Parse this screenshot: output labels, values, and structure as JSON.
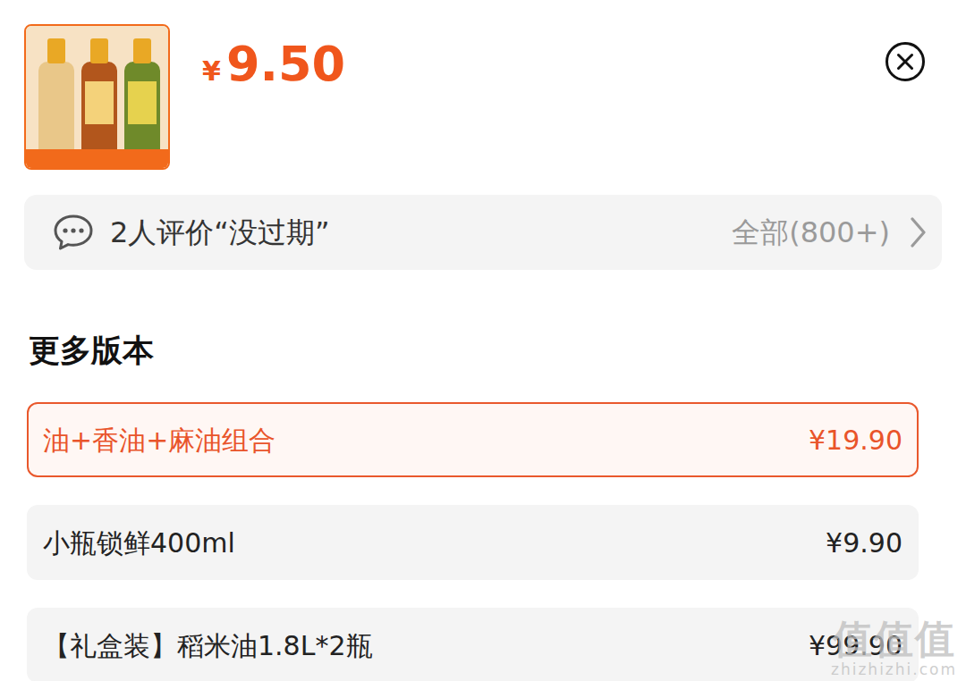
{
  "product": {
    "price": {
      "currency": "¥",
      "amount": "9.50"
    }
  },
  "review": {
    "summary": "2人评价“没过期”",
    "all_link": "全部(800+)"
  },
  "versions": {
    "title": "更多版本",
    "items": [
      {
        "label": "油+香油+麻油组合",
        "price": "¥19.90",
        "selected": true
      },
      {
        "label": "小瓶锁鲜400ml",
        "price": "¥9.90",
        "selected": false
      },
      {
        "label": "【礼盒装】稻米油1.8L*2瓶",
        "price": "¥99.90",
        "selected": false
      }
    ]
  },
  "watermark": {
    "logo": "值值值",
    "site": "zhizhizhi.com"
  }
}
